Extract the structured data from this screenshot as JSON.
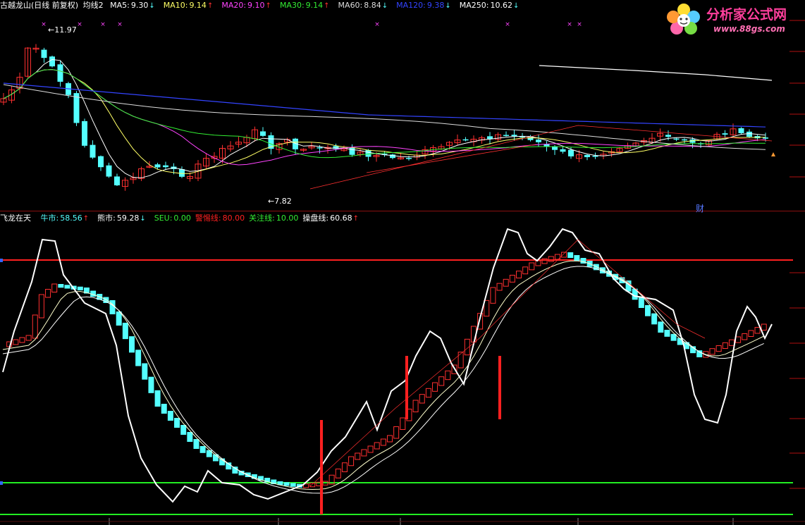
{
  "colors": {
    "background": "#000000",
    "up": "#ff3030",
    "down": "#54ffff",
    "ma5": "#ffffff",
    "ma10": "#ffff66",
    "ma20": "#ff44ff",
    "ma30": "#33ee33",
    "ma60": "#dddddd",
    "ma120": "#3344ff",
    "ma250": "#ffffff",
    "bull": "#54ffff",
    "bear": "#ffffff",
    "alert": "#ff2020",
    "focus": "#22ee22"
  },
  "top": {
    "stock_title": "古越龙山(日线 前复权)",
    "indicator": "均线2",
    "mas": [
      {
        "label": "MA5:",
        "value": "9.30",
        "arrow": "↓",
        "color": "#ffffff"
      },
      {
        "label": "MA10:",
        "value": "9.14",
        "arrow": "↑",
        "color": "#ffff66"
      },
      {
        "label": "MA20:",
        "value": "9.10",
        "arrow": "↑",
        "color": "#ff44ff"
      },
      {
        "label": "MA30:",
        "value": "9.14",
        "arrow": "↑",
        "color": "#33ee33"
      },
      {
        "label": "MA60:",
        "value": "8.84",
        "arrow": "↓",
        "color": "#dddddd"
      },
      {
        "label": "MA120:",
        "value": "9.38",
        "arrow": "↓",
        "color": "#3344ff"
      },
      {
        "label": "MA250:",
        "value": "10.62",
        "arrow": "↓",
        "color": "#ffffff"
      }
    ],
    "high_label": "11.97",
    "low_label": "7.82",
    "cai_label": "财"
  },
  "bottom": {
    "name": "飞龙在天",
    "lines": [
      {
        "label": "牛市:",
        "value": "58.56",
        "arrow": "↑",
        "color": "#54ffff"
      },
      {
        "label": "熊市:",
        "value": "59.28",
        "arrow": "↓",
        "color": "#ffffff"
      },
      {
        "label": "SEU:",
        "value": "0.00",
        "arrow": "",
        "color": "#33ee33"
      },
      {
        "label": "警惕线:",
        "value": "80.00",
        "arrow": "",
        "color": "#ff2020"
      },
      {
        "label": "关注线:",
        "value": "10.00",
        "arrow": "",
        "color": "#33ee33"
      },
      {
        "label": "操盘线:",
        "value": "60.68",
        "arrow": "↑",
        "color": "#ffffff"
      }
    ]
  },
  "logo": {
    "title": "分析家公式网",
    "url": "www.88gs.com"
  }
}
